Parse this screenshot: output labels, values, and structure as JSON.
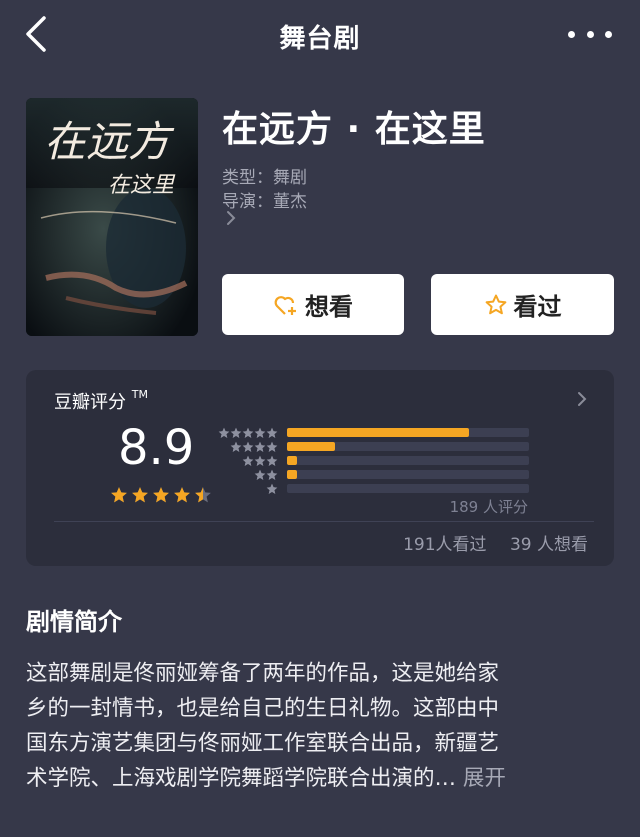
{
  "header": {
    "title": "舞台剧",
    "back_icon": "chevron-left-icon",
    "more_icon": "more-dots-icon"
  },
  "work": {
    "title": "在远方 · 在这里",
    "type_line": "类型：舞剧",
    "director_line": "导演：董杰",
    "poster_text_main": "在远方",
    "poster_text_sub": "在这里"
  },
  "actions": {
    "want_label": "想看",
    "seen_label": "看过"
  },
  "rating": {
    "label": "豆瓣评分",
    "tm": "TM",
    "score": "8.9",
    "stars": 4.5,
    "distribution": [
      0.75,
      0.2,
      0.04,
      0.04,
      0.0
    ],
    "count_text": "189 人评分",
    "seen_text": "191人看过",
    "want_text": "39 人想看"
  },
  "synopsis": {
    "title": "剧情简介",
    "line1": "这部舞剧是佟丽娅筹备了两年的作品，这是她给家",
    "line2": "乡的一封情书，也是给自己的生日礼物。这部由中",
    "line3": "国东方演艺集团与佟丽娅工作室联合出品，新疆艺",
    "line4": "术学院、上海戏剧学院舞蹈学院联合出演的…",
    "expand_label": "展开"
  },
  "colors": {
    "background": "#363849",
    "card": "#2c2e3c",
    "accent": "#f5a623"
  }
}
